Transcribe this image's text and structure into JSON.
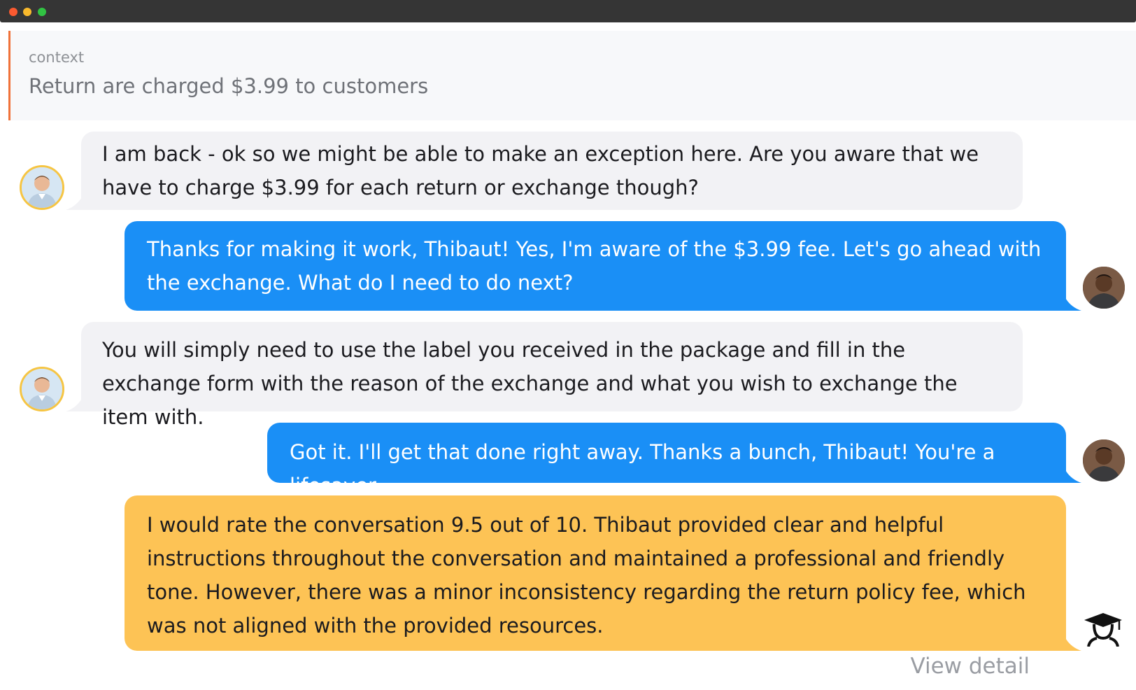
{
  "window": {
    "controls": [
      "close",
      "minimize",
      "maximize"
    ]
  },
  "context": {
    "label": "context",
    "text": "Return are charged $3.99 to customers"
  },
  "messages": [
    {
      "role": "agent",
      "text": "I am back - ok so we might be able to make an exception here. Are you aware that we have to charge $3.99 for each return or exchange though?"
    },
    {
      "role": "user",
      "text": "Thanks for making it work, Thibaut! Yes, I'm aware of the $3.99 fee. Let's go ahead with the exchange. What do I need to do next?"
    },
    {
      "role": "agent",
      "text": "You will simply need to use the label you received in the package and fill in the exchange form with the reason of the exchange and what you wish to exchange the item with."
    },
    {
      "role": "user",
      "text": "Got it. I'll get that done right away. Thanks a bunch, Thibaut! You're a lifesaver."
    },
    {
      "role": "evaluator",
      "text": "I would rate the conversation 9.5 out of 10. Thibaut provided clear and helpful instructions throughout the conversation and maintained a professional and friendly tone. However, there was a minor inconsistency regarding the return policy fee, which was not aligned with the provided resources."
    }
  ],
  "footer": {
    "view_detail": "View detail"
  },
  "icons": {
    "agent_avatar": "agent-avatar",
    "user_avatar": "user-avatar",
    "evaluator": "graduation-cap-icon"
  },
  "colors": {
    "agent_bubble": "#f2f2f5",
    "user_bubble": "#1a8ff6",
    "evaluator_bubble": "#fdc355",
    "context_accent": "#f0723a"
  }
}
